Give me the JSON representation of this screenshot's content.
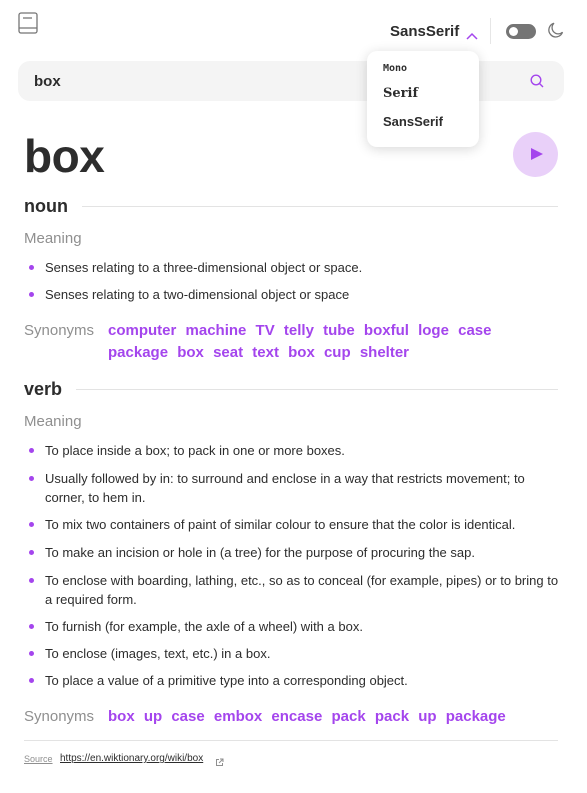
{
  "header": {
    "logo_icon": "book-icon",
    "font_selected": "SansSerif",
    "chevron_icon": "chevron-up-icon",
    "theme_toggle_on": false,
    "theme_icon": "moon-icon"
  },
  "dropdown": {
    "options": [
      "Mono",
      "Serif",
      "SansSerif"
    ]
  },
  "search": {
    "value": "box",
    "icon": "search-icon"
  },
  "entry": {
    "word": "box",
    "play_icon": "play-icon",
    "meanings": [
      {
        "part_of_speech": "noun",
        "meaning_label": "Meaning",
        "definitions": [
          "Senses relating to a three-dimensional object or space.",
          "Senses relating to a two-dimensional object or space"
        ],
        "synonyms_label": "Synonyms",
        "synonyms": [
          "computer",
          "machine",
          "TV",
          "telly",
          "tube",
          "boxful",
          "loge",
          "case",
          "package",
          "box",
          "seat",
          "text",
          "box",
          "cup",
          "shelter"
        ]
      },
      {
        "part_of_speech": "verb",
        "meaning_label": "Meaning",
        "definitions": [
          "To place inside a box; to pack in one or more boxes.",
          "Usually followed by in: to surround and enclose in a way that restricts movement; to corner, to hem in.",
          "To mix two containers of paint of similar colour to ensure that the color is identical.",
          "To make an incision or hole in (a tree) for the purpose of procuring the sap.",
          "To enclose with boarding, lathing, etc., so as to conceal (for example, pipes) or to bring to a required form.",
          "To furnish (for example, the axle of a wheel) with a box.",
          "To enclose (images, text, etc.) in a box.",
          "To place a value of a primitive type into a corresponding object."
        ],
        "synonyms_label": "Synonyms",
        "synonyms": [
          "box",
          "up",
          "case",
          "embox",
          "encase",
          "pack",
          "pack",
          "up",
          "package"
        ]
      }
    ]
  },
  "footer": {
    "source_label": "Source",
    "source_url": "https://en.wiktionary.org/wiki/box",
    "external_icon": "external-link-icon"
  },
  "colors": {
    "accent": "#a445ed",
    "accent_light": "#e9d0f9",
    "text": "#2d2d2d",
    "muted": "#8f8f8f",
    "search_bg": "#f4f4f4"
  }
}
